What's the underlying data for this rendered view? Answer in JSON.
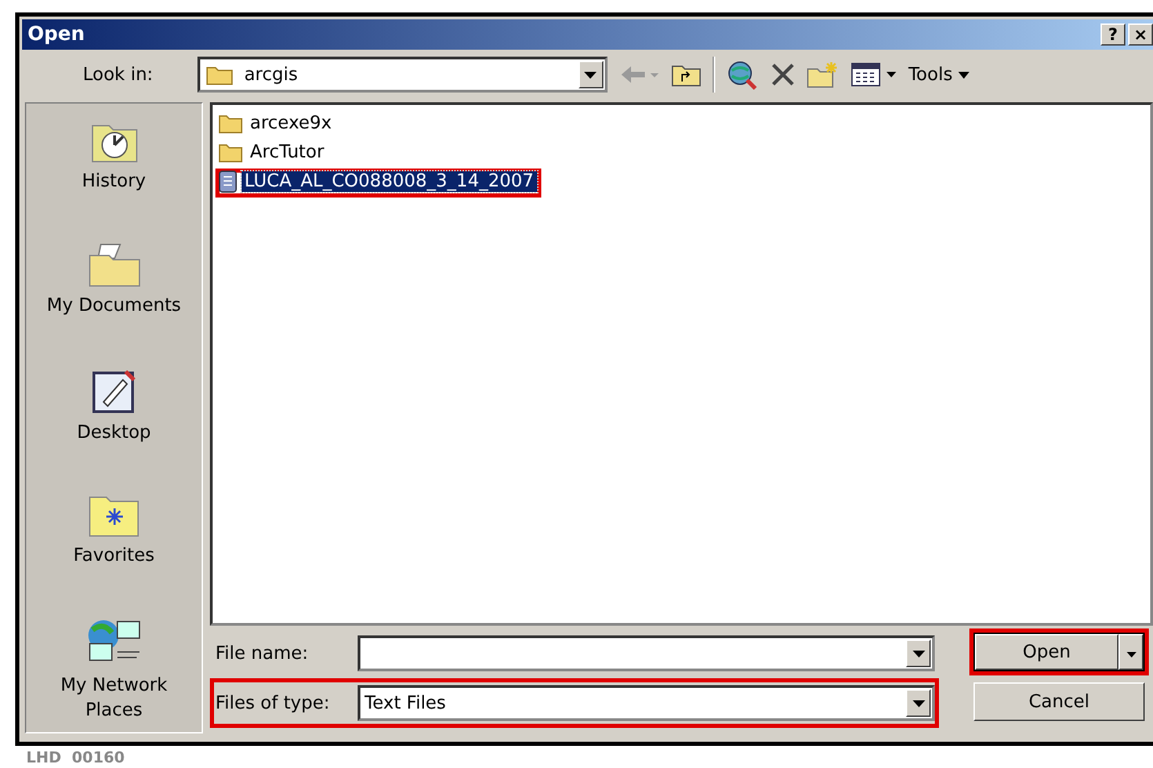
{
  "window": {
    "title": "Open",
    "buttons": [
      "?",
      "×"
    ]
  },
  "toolbar": {
    "look_in_label": "Look in:",
    "look_in_value": "arcgis",
    "tools_label": "Tools"
  },
  "places": [
    {
      "label": "History",
      "kind": "history"
    },
    {
      "label": "My Documents",
      "kind": "documents"
    },
    {
      "label": "Desktop",
      "kind": "desktop"
    },
    {
      "label": "Favorites",
      "kind": "favorites"
    },
    {
      "label": "My Network Places",
      "kind": "network"
    }
  ],
  "files": [
    {
      "name": "arcexe9x",
      "kind": "folder",
      "selected": false,
      "annotated": false
    },
    {
      "name": "ArcTutor",
      "kind": "folder",
      "selected": false,
      "annotated": false
    },
    {
      "name": "LUCA_AL_CO088008_3_14_2007",
      "kind": "text",
      "selected": true,
      "annotated": true
    }
  ],
  "file_name": {
    "label": "File name:",
    "annotated": false
  },
  "files_of_type": {
    "label": "Files of type:",
    "value": "Text Files",
    "annotated": true
  },
  "buttons": [
    {
      "label": "Open",
      "kind": "split",
      "annotated": true
    },
    {
      "label": "Cancel",
      "kind": "plain",
      "annotated": false
    }
  ],
  "footer": "LHD  00160"
}
